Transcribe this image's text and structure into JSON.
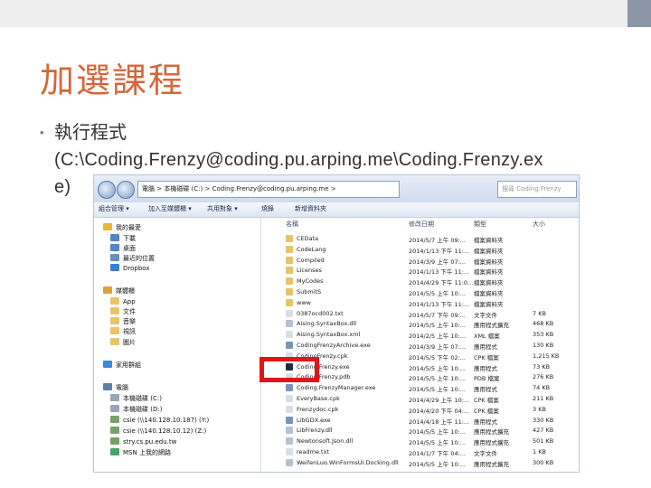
{
  "slide": {
    "title": "加選課程",
    "bullet_line1": "執行程式",
    "bullet_line2": "(C:\\Coding.Frenzy@coding.pu.arping.me\\Coding.Frenzy.ex",
    "bullet_line3": "e)"
  },
  "explorer": {
    "address": "電腦 > 本機磁碟 (C:) > Coding.Frenzy@coding.pu.arping.me >",
    "search_placeholder": "搜尋 Coding.Frenzy",
    "toolbar": [
      "組合管理 ▾",
      "加入至媒體櫃 ▾",
      "共用對象 ▾",
      "燒錄",
      "新增資料夾"
    ],
    "sidebar": [
      {
        "label": "我的最愛",
        "icon": "star-icon",
        "color": "#e8b83a"
      },
      {
        "label": "下載",
        "icon": "download-folder-icon",
        "color": "#4f86c6"
      },
      {
        "label": "桌面",
        "icon": "desktop-icon",
        "color": "#4f86c6"
      },
      {
        "label": "最近的位置",
        "icon": "recent-places-icon",
        "color": "#6a8fb8"
      },
      {
        "label": "Dropbox",
        "icon": "dropbox-icon",
        "color": "#3b7fd0"
      },
      {
        "label": "媒體櫃",
        "icon": "library-icon",
        "color": "#d9a43a"
      },
      {
        "label": "App",
        "icon": "folder-icon",
        "color": "#e7c46a"
      },
      {
        "label": "文件",
        "icon": "documents-icon",
        "color": "#e7c46a"
      },
      {
        "label": "音樂",
        "icon": "music-icon",
        "color": "#e7c46a"
      },
      {
        "label": "視訊",
        "icon": "video-icon",
        "color": "#e7c46a"
      },
      {
        "label": "圖片",
        "icon": "pictures-icon",
        "color": "#e7c46a"
      },
      {
        "label": "家用群組",
        "icon": "homegroup-icon",
        "color": "#3a8ad8"
      },
      {
        "label": "電腦",
        "icon": "computer-icon",
        "color": "#5f7fa6"
      },
      {
        "label": "本機磁碟 (C:)",
        "icon": "drive-icon",
        "color": "#9aa6b5"
      },
      {
        "label": "本機磁碟 (D:)",
        "icon": "drive-icon",
        "color": "#9aa6b5"
      },
      {
        "label": "csie (\\\\140.128.10.187) (Y:)",
        "icon": "network-drive-icon",
        "color": "#7aa06a"
      },
      {
        "label": "csie (\\\\140.128.10.12) (Z:)",
        "icon": "network-drive-icon",
        "color": "#7aa06a"
      },
      {
        "label": "stry.cs.pu.edu.tw",
        "icon": "network-drive-icon",
        "color": "#7aa06a"
      },
      {
        "label": "MSN 上我的網路",
        "icon": "msn-icon",
        "color": "#4aa36a"
      }
    ],
    "columns": [
      "名稱",
      "修改日期",
      "類型",
      "大小"
    ],
    "files": [
      {
        "name": "CEData",
        "date": "2014/5/7 上午 09:...",
        "type": "檔案資料夾",
        "size": "",
        "icon_color": "#e7c46a"
      },
      {
        "name": "CodeLang",
        "date": "2014/1/13 下午 11:...",
        "type": "檔案資料夾",
        "size": "",
        "icon_color": "#e7c46a"
      },
      {
        "name": "Compiled",
        "date": "2014/3/9 上午 07:...",
        "type": "檔案資料夾",
        "size": "",
        "icon_color": "#e7c46a"
      },
      {
        "name": "Licenses",
        "date": "2014/1/13 下午 11:...",
        "type": "檔案資料夾",
        "size": "",
        "icon_color": "#e7c46a"
      },
      {
        "name": "MyCodes",
        "date": "2014/4/29 下午 11:0...",
        "type": "檔案資料夾",
        "size": "",
        "icon_color": "#e7c46a"
      },
      {
        "name": "SubmitS",
        "date": "2014/5/5 上午 10:...",
        "type": "檔案資料夾",
        "size": "",
        "icon_color": "#e7c46a"
      },
      {
        "name": "www",
        "date": "2014/1/13 下午 11:...",
        "type": "檔案資料夾",
        "size": "",
        "icon_color": "#e7c46a"
      },
      {
        "name": "0387ocd002.txt",
        "date": "2014/5/7 下午 09:...",
        "type": "文字文件",
        "size": "7 KB",
        "icon_color": "#d9dee6"
      },
      {
        "name": "Aising.SyntaxBox.dll",
        "date": "2014/5/5 上午 10:...",
        "type": "應用程式擴充",
        "size": "468 KB",
        "icon_color": "#b6c2d2"
      },
      {
        "name": "Aising.SyntaxBox.xml",
        "date": "2014/2/5 上午 10:...",
        "type": "XML 檔案",
        "size": "353 KB",
        "icon_color": "#d9dee6"
      },
      {
        "name": "CodingFrenzyArchive.exe",
        "date": "2014/3/9 上午 07:...",
        "type": "應用程式",
        "size": "130 KB",
        "icon_color": "#7c94b8"
      },
      {
        "name": "CodingFrenzy.cpk",
        "date": "2014/5/5 下午 02:...",
        "type": "CPK 檔案",
        "size": "1,215 KB",
        "icon_color": "#d9dee6"
      },
      {
        "name": "Coding.Frenzy.exe",
        "date": "2014/5/5 上午 10:...",
        "type": "應用程式",
        "size": "73 KB",
        "icon_color": "#1f2d44"
      },
      {
        "name": "Coding.Frenzy.pdb",
        "date": "2014/5/5 上午 10:...",
        "type": "PDB 檔案",
        "size": "276 KB",
        "icon_color": "#d9dee6"
      },
      {
        "name": "Coding.FrenzyManager.exe",
        "date": "2014/5/5 上午 10:...",
        "type": "應用程式",
        "size": "74 KB",
        "icon_color": "#7c94b8"
      },
      {
        "name": "EveryBase.cpk",
        "date": "2014/4/29 上午 10:...",
        "type": "CPK 檔案",
        "size": "211 KB",
        "icon_color": "#d9dee6"
      },
      {
        "name": "Frenzydoc.cpk",
        "date": "2014/4/20 下午 04:...",
        "type": "CPK 檔案",
        "size": "3 KB",
        "icon_color": "#d9dee6"
      },
      {
        "name": "LibGDX.exe",
        "date": "2014/4/18 上午 11:...",
        "type": "應用程式",
        "size": "330 KB",
        "icon_color": "#7c94b8"
      },
      {
        "name": "LibFrenzy.dll",
        "date": "2014/5/5 上午 10:...",
        "type": "應用程式擴充",
        "size": "427 KB",
        "icon_color": "#b6c2d2"
      },
      {
        "name": "Newtonsoft.Json.dll",
        "date": "2014/5/5 上午 10:...",
        "type": "應用程式擴充",
        "size": "501 KB",
        "icon_color": "#b6c2d2"
      },
      {
        "name": "readme.txt",
        "date": "2014/1/7 下午 04:...",
        "type": "文字文件",
        "size": "1 KB",
        "icon_color": "#d9dee6"
      },
      {
        "name": "WeifenLuo.WinFormsUI.Docking.dll",
        "date": "2014/5/5 上午 10:...",
        "type": "應用程式擴充",
        "size": "300 KB",
        "icon_color": "#b6c2d2"
      }
    ],
    "highlight_color": "#e0141a"
  }
}
